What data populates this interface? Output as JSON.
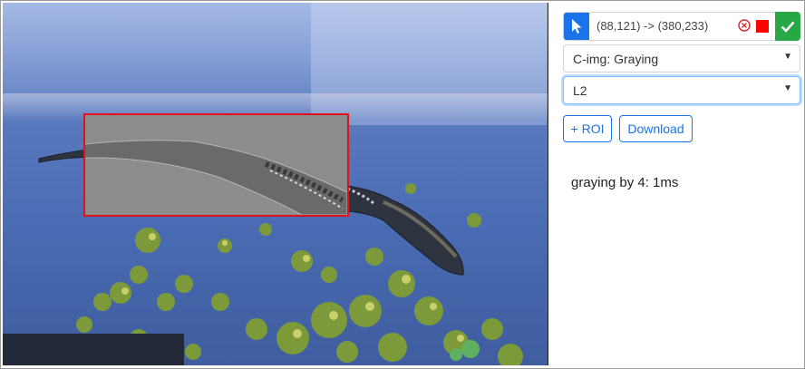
{
  "roi": {
    "coordinates_text": "(88,121) -> (380,233)",
    "color": "#ff0000"
  },
  "controls": {
    "pointer_tool": "cursor-icon",
    "confirm": "check-icon",
    "clear": "clear-icon",
    "filter_select": {
      "value": "C-img: Graying"
    },
    "level_select": {
      "value": "L2"
    },
    "add_roi_label": "+ ROI",
    "download_label": "Download"
  },
  "status": {
    "message": "graying by 4: 1ms"
  },
  "colors": {
    "accent": "#1a73e8",
    "confirm": "#28a745",
    "roi_border": "#e0111b"
  }
}
